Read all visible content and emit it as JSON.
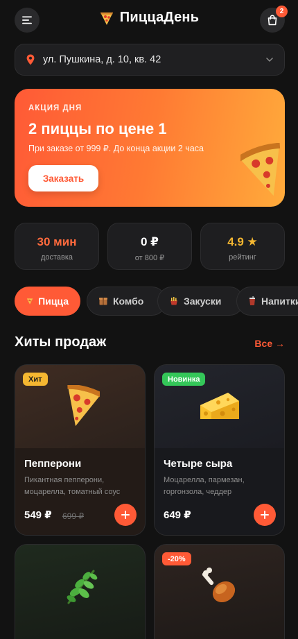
{
  "header": {
    "brand": "ПиццаДень",
    "cart_count": "2"
  },
  "address": {
    "text": "ул. Пушкина, д. 10, кв. 42"
  },
  "promo": {
    "tag": "АКЦИЯ ДНЯ",
    "title": "2 пиццы по цене 1",
    "subtitle": "При заказе от 999 ₽. До конца акции 2 часа",
    "button": "Заказать"
  },
  "stats": [
    {
      "value": "30 мин",
      "label": "доставка",
      "color": "#ff6a3d"
    },
    {
      "value": "0 ₽",
      "label": "от 800 ₽",
      "color": "#ffffff"
    },
    {
      "value": "4.9 ★",
      "label": "рейтинг",
      "color": "#f5b731"
    }
  ],
  "categories": [
    {
      "label": "Пицца",
      "icon": "pizza-icon"
    },
    {
      "label": "Комбо",
      "icon": "box-icon"
    },
    {
      "label": "Закуски",
      "icon": "snack-icon"
    },
    {
      "label": "Напитки",
      "icon": "drink-icon"
    }
  ],
  "section": {
    "title": "Хиты продаж",
    "see_all": "Все →"
  },
  "products": [
    {
      "badge": "Хит",
      "badge_color": "#f5b731",
      "name": "Пепперони",
      "desc": "Пикантная пепперони, моцарелла, томатный соус",
      "price": "549 ₽",
      "old_price": "699 ₽",
      "icon": "pizza-slice-icon"
    },
    {
      "badge": "Новинка",
      "badge_color": "#34c759",
      "name": "Четыре сыра",
      "desc": "Моцарелла, пармезан, горгонзола, чеддер",
      "price": "649 ₽",
      "old_price": "",
      "icon": "cheese-icon"
    },
    {
      "badge": "",
      "badge_color": "",
      "name": "",
      "desc": "",
      "price": "",
      "old_price": "",
      "icon": "herb-icon"
    },
    {
      "badge": "-20%",
      "badge_color": "#ff5a36",
      "name": "",
      "desc": "",
      "price": "",
      "old_price": "",
      "icon": "chicken-leg-icon"
    }
  ]
}
